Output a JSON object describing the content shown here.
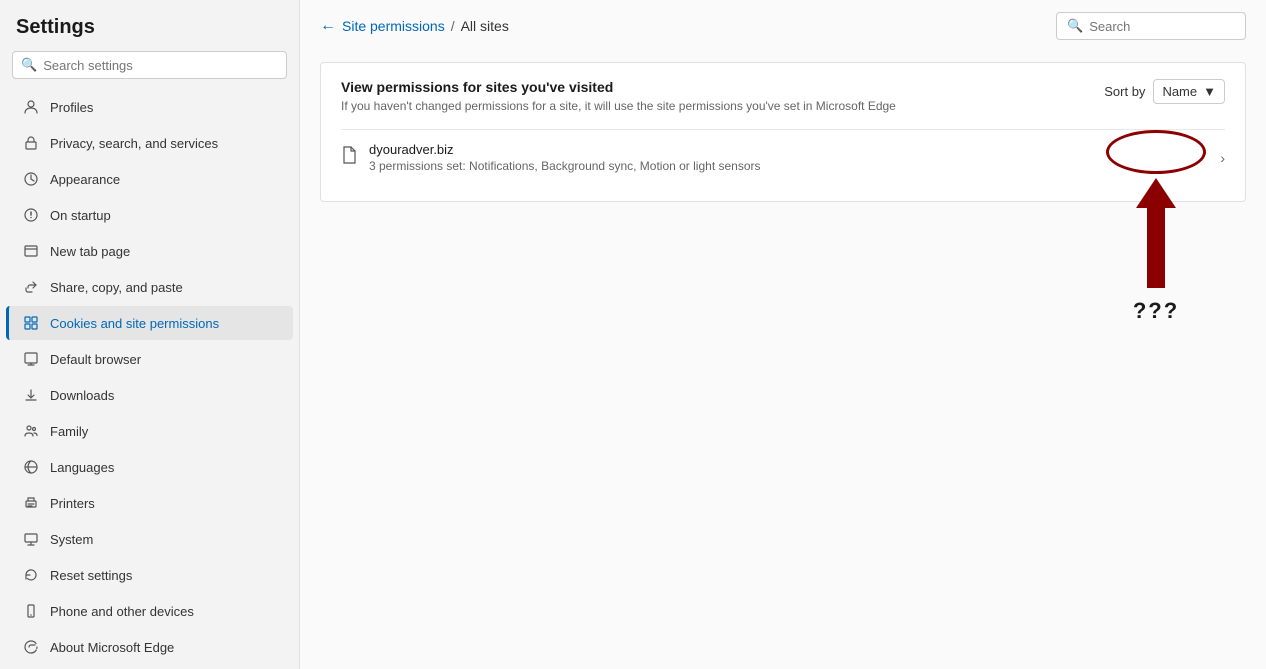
{
  "sidebar": {
    "title": "Settings",
    "search_placeholder": "Search settings",
    "items": [
      {
        "id": "profiles",
        "label": "Profiles",
        "icon": "person"
      },
      {
        "id": "privacy",
        "label": "Privacy, search, and services",
        "icon": "lock"
      },
      {
        "id": "appearance",
        "label": "Appearance",
        "icon": "eye"
      },
      {
        "id": "on-startup",
        "label": "On startup",
        "icon": "power"
      },
      {
        "id": "new-tab",
        "label": "New tab page",
        "icon": "tab"
      },
      {
        "id": "share",
        "label": "Share, copy, and paste",
        "icon": "share"
      },
      {
        "id": "cookies",
        "label": "Cookies and site permissions",
        "icon": "grid",
        "active": true
      },
      {
        "id": "default-browser",
        "label": "Default browser",
        "icon": "browser"
      },
      {
        "id": "downloads",
        "label": "Downloads",
        "icon": "download"
      },
      {
        "id": "family",
        "label": "Family",
        "icon": "family"
      },
      {
        "id": "languages",
        "label": "Languages",
        "icon": "language"
      },
      {
        "id": "printers",
        "label": "Printers",
        "icon": "printer"
      },
      {
        "id": "system",
        "label": "System",
        "icon": "system"
      },
      {
        "id": "reset",
        "label": "Reset settings",
        "icon": "reset"
      },
      {
        "id": "phone",
        "label": "Phone and other devices",
        "icon": "phone"
      },
      {
        "id": "about",
        "label": "About Microsoft Edge",
        "icon": "edge"
      }
    ]
  },
  "header": {
    "back_arrow": "←",
    "breadcrumb_link": "Site permissions",
    "breadcrumb_sep": "/",
    "breadcrumb_current": "All sites",
    "search_placeholder": "Search"
  },
  "content": {
    "card_title": "View permissions for sites you've visited",
    "card_subtitle": "If you haven't changed permissions for a site, it will use the site permissions you've set in Microsoft Edge",
    "sort_label": "Sort by",
    "sort_value": "Name",
    "site": {
      "name": "dyouradver.biz",
      "description": "3 permissions set: Notifications, Background sync, Motion or light sensors"
    }
  },
  "annotation": {
    "question_marks": "???"
  }
}
